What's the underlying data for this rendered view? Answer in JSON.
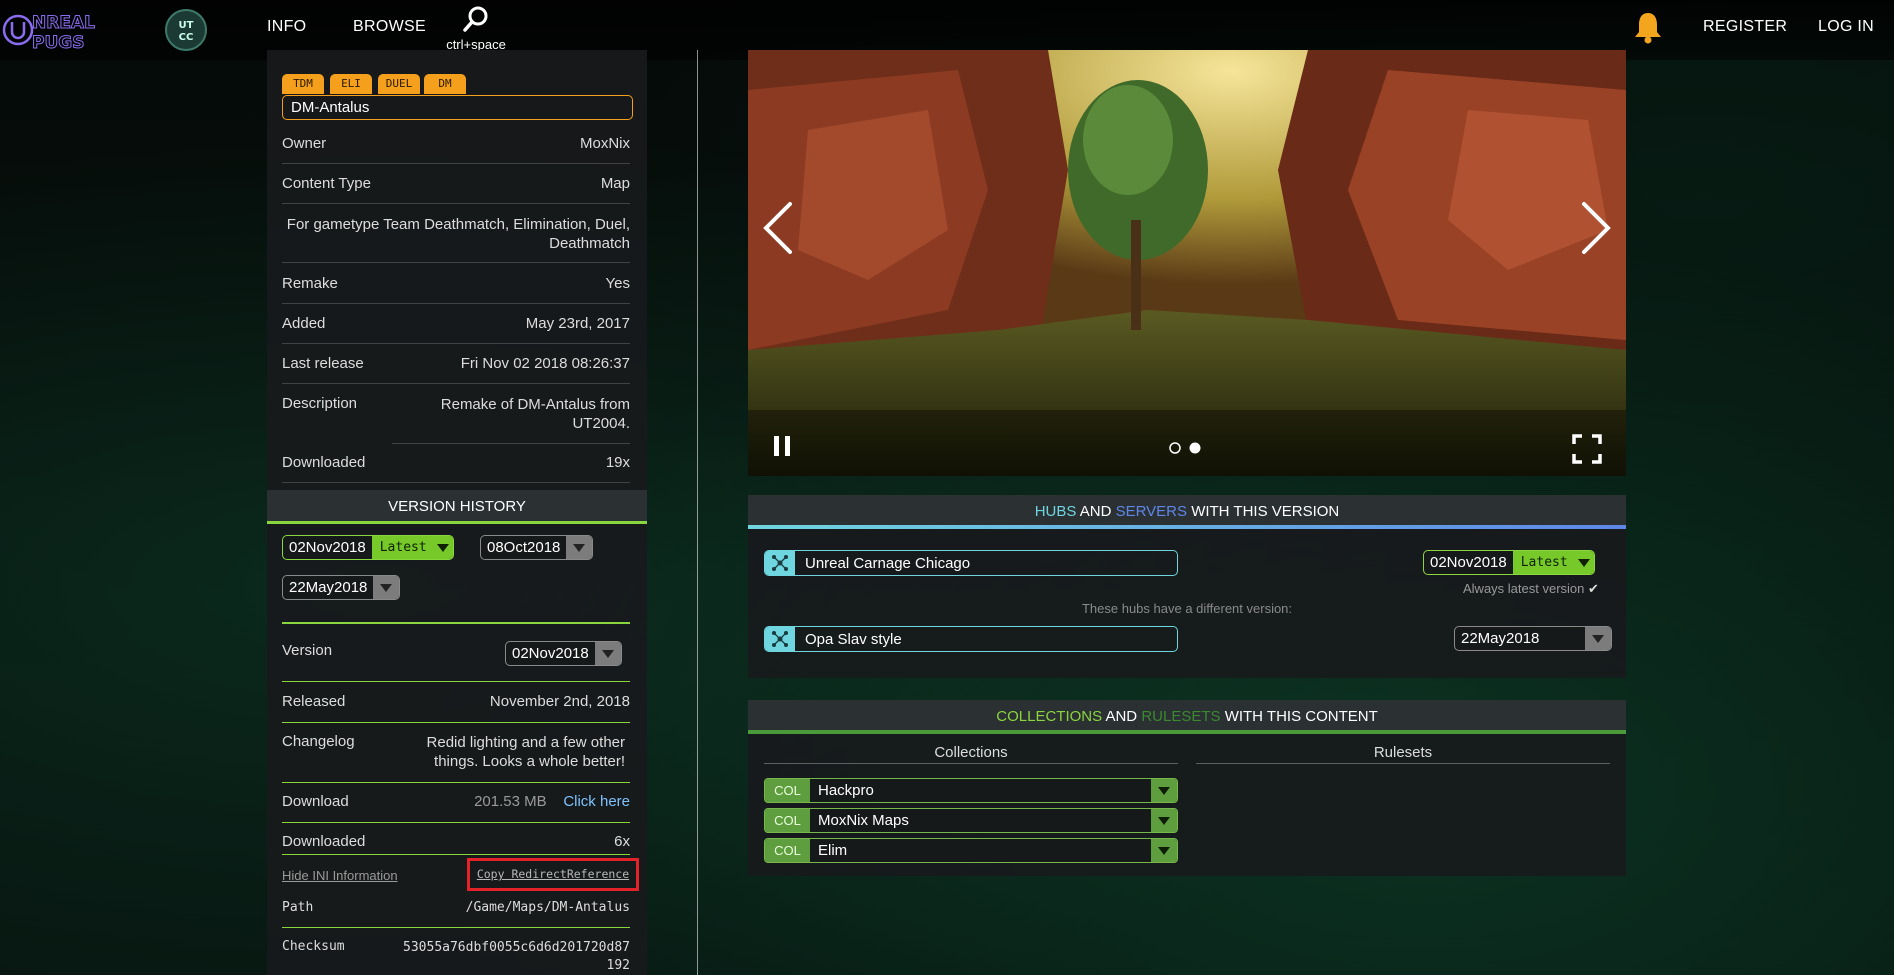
{
  "nav": {
    "logo_text": "UNREAL PUGS",
    "utcc_text": "UT CC",
    "info": "INFO",
    "browse": "BROWSE",
    "search_hint": "ctrl+space",
    "register": "REGISTER",
    "login": "LOG IN"
  },
  "map": {
    "tags": [
      "TDM",
      "ELI",
      "DUEL",
      "DM"
    ],
    "name": "DM-Antalus",
    "details": [
      {
        "label": "Owner",
        "value": "MoxNix"
      },
      {
        "label": "Content Type",
        "value": "Map"
      },
      {
        "label": "For gametype Team Deathmatch, Elimination, Duel, Deathmatch",
        "value": ""
      },
      {
        "label": "Remake",
        "value": "Yes"
      },
      {
        "label": "Added",
        "value": "May 23rd, 2017"
      },
      {
        "label": "Last release",
        "value": "Fri Nov 02 2018 08:26:37"
      },
      {
        "label": "Description",
        "value": "Remake of DM-Antalus from UT2004."
      },
      {
        "label": "Downloaded",
        "value": "19x"
      }
    ]
  },
  "version_history": {
    "title": "VERSION HISTORY",
    "versions": [
      {
        "date": "02Nov2018",
        "latest": "Latest"
      },
      {
        "date": "08Oct2018"
      },
      {
        "date": "22May2018"
      }
    ]
  },
  "version_detail": {
    "version_label": "Version",
    "version_value": "02Nov2018",
    "released_label": "Released",
    "released_value": "November 2nd, 2018",
    "changelog_label": "Changelog",
    "changelog_value": "Redid lighting and a few other things. Looks a whole better!",
    "download_label": "Download",
    "download_size": "201.53 MB",
    "download_link": "Click here",
    "downloaded_label": "Downloaded",
    "downloaded_value": "6x",
    "hide_ini": "Hide INI Information",
    "copy_redirect": "Copy RedirectReference",
    "path_label": "Path",
    "path_value": "/Game/Maps/DM-Antalus",
    "checksum_label": "Checksum",
    "checksum_value": "53055a76dbf0055c6d6d201720d87192"
  },
  "carousel": {
    "slides": 2,
    "active": 2
  },
  "hubs": {
    "title_hubs": "HUBS",
    "title_and": "AND",
    "title_servers": "SERVERS",
    "title_rest": "WITH THIS VERSION",
    "current": [
      {
        "name": "Unreal Carnage Chicago",
        "version": "02Nov2018",
        "latest": "Latest"
      }
    ],
    "always_latest": "Always latest version",
    "different_note": "These hubs have a different version:",
    "different": [
      {
        "name": "Opa Slav style",
        "version": "22May2018"
      }
    ]
  },
  "collections": {
    "title_collections": "COLLECTIONS",
    "title_and": "AND",
    "title_rulesets": "RULESETS",
    "title_rest": "WITH THIS CONTENT",
    "col_header": "Collections",
    "rule_header": "Rulesets",
    "col_badge": "COL",
    "items": [
      "Hackpro",
      "MoxNix Maps",
      "Elim"
    ]
  },
  "colors": {
    "accent_green": "#8ad63e",
    "orange": "#f4a01c",
    "cyan": "#6fd6e0",
    "blue": "#5e87e8",
    "red_highlight": "#e3222a"
  }
}
